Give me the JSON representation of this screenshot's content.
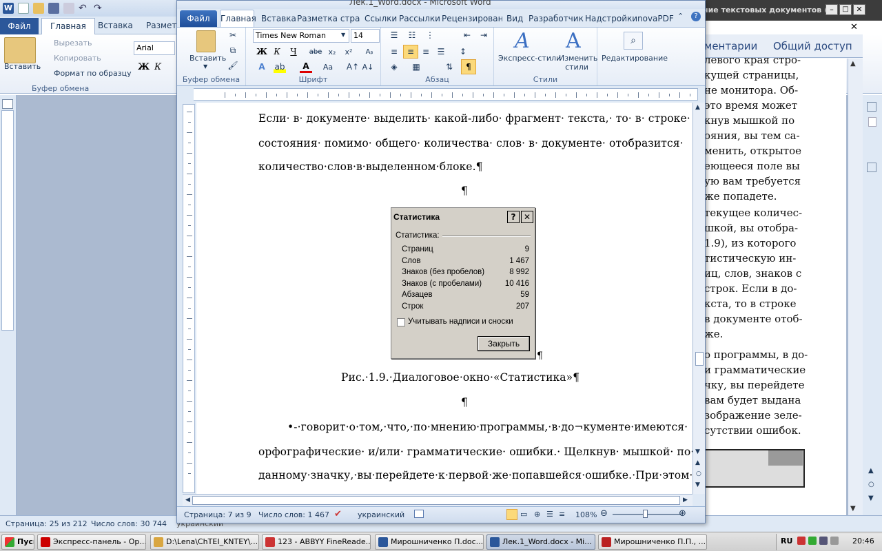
{
  "bg_window": {
    "tabs": [
      "Файл",
      "Главная",
      "Вставка",
      "Разметка"
    ],
    "clipboard": {
      "paste": "Вставить",
      "cut": "Вырезать",
      "copy": "Копировать",
      "format": "Формат по образцу",
      "group": "Буфер обмена"
    },
    "font": "Arial",
    "right_tabs": [
      "ментарии",
      "Общий доступ"
    ],
    "title_fragment": "ние текстовых документов (...",
    "status_page": "Страница: 25 из 212",
    "status_words": "Число слов: 30 744",
    "status_lang": "украинский",
    "right_text": [
      "левого края стро-",
      "кущей страницы,",
      "не монитора. Об-",
      "это время может",
      "кнув мышкой по",
      "ояния, вы тем са-",
      "менить, открытое",
      "еющееся поле вы",
      "ую вам требуется",
      "же попадете.",
      "текущее количес-",
      "шкой, вы отобра-",
      "1.9), из которого",
      "тистическую ин-",
      "иц, слов, знаков с",
      "строк. Если в до-",
      "кста, то в строке",
      "в документе отоб-",
      "же.",
      "о программы, в до-",
      "и грамматические",
      "чку, вы перейдете",
      "вам будет выдана",
      "зображение зеле-",
      "сутствии ошибок."
    ]
  },
  "window": {
    "title": "Лек.1_Word.docx - Microsoft Word",
    "tabs": {
      "file": "Файл",
      "home": "Главная",
      "insert": "Вставка",
      "layout": "Разметка страни",
      "refs": "Ссылки",
      "mailings": "Рассылки",
      "review": "Рецензировани",
      "view": "Вид",
      "dev": "Разработчик",
      "addins": "Надстройки",
      "nova": "novaPDF"
    },
    "ribbon": {
      "paste": "Вставить",
      "clipboard_group": "Буфер обмена",
      "font_name": "Times New Roman",
      "font_size": "14",
      "font_group": "Шрифт",
      "para_group": "Абзац",
      "express_styles": "Экспресс-стили",
      "change_styles": "Изменить стили",
      "styles_group": "Стили",
      "editing": "Редактирование"
    },
    "document": {
      "p1_l1": "Если· в· документе· выделить· какой-либо· фрагмент· текста,· то· в· строке·",
      "p1_l2": "состояния· помимо· общего· количества· слов· в· документе· отобразится·",
      "p1_l3": "количество·слов·в·выделенном·блоке.¶",
      "pilcrow": "¶",
      "caption": "Рис.·1.9.·Диалоговое·окно·«Статистика»¶",
      "p2_l1": "•-·говорит·о·том,·что,·по·мнению·программы,·в·до¬кументе·имеются·",
      "p2_l2": "орфографические· и/или· грамматические· ошибки.· Щелкнув· мышкой· по·",
      "p2_l3": "данному·значку,·вы·перейдете·к·первой·же·попавшейся·ошибке.·При·этом·"
    },
    "dialog": {
      "title": "Статистика",
      "help": "?",
      "close_x": "✕",
      "section": "Статистика:",
      "rows": [
        {
          "label": "Страниц",
          "value": "9"
        },
        {
          "label": "Слов",
          "value": "1 467"
        },
        {
          "label": "Знаков (без пробелов)",
          "value": "8 992"
        },
        {
          "label": "Знаков (с пробелами)",
          "value": "10 416"
        },
        {
          "label": "Абзацев",
          "value": "59"
        },
        {
          "label": "Строк",
          "value": "207"
        }
      ],
      "checkbox": "Учитывать надписи и сноски",
      "close_btn": "Закрыть"
    },
    "status": {
      "page": "Страница: 7 из 9",
      "words": "Число слов: 1 467",
      "lang": "украинский",
      "zoom": "108%"
    }
  },
  "taskbar": {
    "start": "Пуск",
    "items": [
      "Экспресс-панель - Op...",
      "D:\\Lena\\ChTEI_KNTEY\\...",
      "123 - ABBYY FineReade...",
      "Мирошниченко П.doc...",
      "Лек.1_Word.docx - Mi...",
      "Мирошниченко П.П., ..."
    ],
    "lang": "RU",
    "time": "20:46"
  },
  "colors": {
    "accent": "#2b579a",
    "ribbon": "#dfe9f5",
    "doc_bg": "#abbad0"
  }
}
